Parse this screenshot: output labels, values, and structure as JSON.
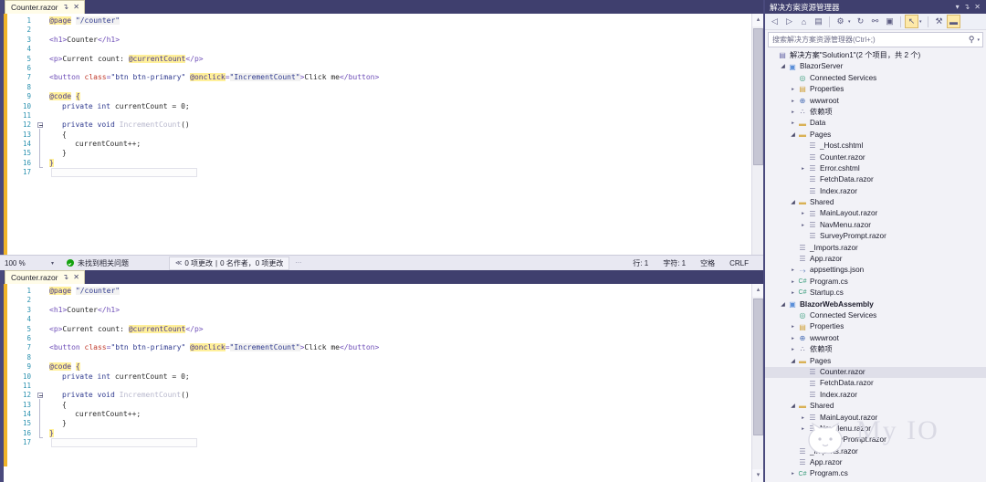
{
  "editor": {
    "tab": {
      "title": "Counter.razor",
      "pin_icon": "pin-icon",
      "close_icon": "close-icon",
      "close_glyph": "✕",
      "pin_glyph": "↴"
    },
    "line_count": 17,
    "code_lines": [
      {
        "n": 1,
        "indent": 0,
        "tokens": [
          {
            "t": "@page",
            "c": "hl-razor"
          },
          {
            "t": " ",
            "c": "t-plain"
          },
          {
            "t": "\"/counter\"",
            "c": "t-str hl-str-bg"
          }
        ]
      },
      {
        "n": 2,
        "indent": 0,
        "tokens": []
      },
      {
        "n": 3,
        "indent": 0,
        "tokens": [
          {
            "t": "<h1>",
            "c": "t-tag"
          },
          {
            "t": "Counter",
            "c": "t-text"
          },
          {
            "t": "</h1>",
            "c": "t-tag"
          }
        ]
      },
      {
        "n": 4,
        "indent": 0,
        "tokens": []
      },
      {
        "n": 5,
        "indent": 0,
        "tokens": [
          {
            "t": "<p>",
            "c": "t-tag"
          },
          {
            "t": "Current count: ",
            "c": "t-text"
          },
          {
            "t": "@currentCount",
            "c": "hl-razor"
          },
          {
            "t": "</p>",
            "c": "t-tag"
          }
        ]
      },
      {
        "n": 6,
        "indent": 0,
        "tokens": []
      },
      {
        "n": 7,
        "indent": 0,
        "tokens": [
          {
            "t": "<button ",
            "c": "t-tag"
          },
          {
            "t": "class",
            "c": "t-attr"
          },
          {
            "t": "=",
            "c": "t-tag"
          },
          {
            "t": "\"btn btn-primary\"",
            "c": "t-str"
          },
          {
            "t": " ",
            "c": "t-plain"
          },
          {
            "t": "@onclick",
            "c": "hl-razor"
          },
          {
            "t": "=",
            "c": "t-tag"
          },
          {
            "t": "\"IncrementCount\"",
            "c": "t-str hl-str-bg"
          },
          {
            "t": ">",
            "c": "t-tag"
          },
          {
            "t": "Click me",
            "c": "t-text"
          },
          {
            "t": "</button>",
            "c": "t-tag"
          }
        ]
      },
      {
        "n": 8,
        "indent": 0,
        "tokens": []
      },
      {
        "n": 9,
        "indent": 0,
        "tokens": [
          {
            "t": "@code",
            "c": "hl-razor"
          },
          {
            "t": " ",
            "c": "t-plain"
          },
          {
            "t": "{",
            "c": "hl-brace"
          }
        ]
      },
      {
        "n": 10,
        "indent": 1,
        "tokens": [
          {
            "t": "private",
            "c": "t-kw"
          },
          {
            "t": " ",
            "c": "t-plain"
          },
          {
            "t": "int",
            "c": "t-type"
          },
          {
            "t": " currentCount = ",
            "c": "t-plain"
          },
          {
            "t": "0",
            "c": "t-num"
          },
          {
            "t": ";",
            "c": "t-plain"
          }
        ]
      },
      {
        "n": 11,
        "indent": 0,
        "tokens": []
      },
      {
        "n": 12,
        "indent": 1,
        "fold": "start",
        "tokens": [
          {
            "t": "private",
            "c": "t-kw"
          },
          {
            "t": " ",
            "c": "t-plain"
          },
          {
            "t": "void",
            "c": "t-kw"
          },
          {
            "t": " ",
            "c": "t-plain"
          },
          {
            "t": "IncrementCount",
            "c": "t-ident"
          },
          {
            "t": "()",
            "c": "t-plain"
          }
        ]
      },
      {
        "n": 13,
        "indent": 1,
        "tokens": [
          {
            "t": "{",
            "c": "t-plain"
          }
        ]
      },
      {
        "n": 14,
        "indent": 2,
        "tokens": [
          {
            "t": "currentCount++;",
            "c": "t-plain"
          }
        ]
      },
      {
        "n": 15,
        "indent": 1,
        "tokens": [
          {
            "t": "}",
            "c": "t-plain"
          }
        ]
      },
      {
        "n": 16,
        "indent": 0,
        "tokens": [
          {
            "t": "}",
            "c": "hl-brace"
          }
        ]
      },
      {
        "n": 17,
        "indent": 0,
        "tokens": []
      }
    ]
  },
  "statusbar": {
    "zoom_level": "100 %",
    "zoom_caret": "▾",
    "issue_status": "未找到相关问题",
    "ok_icon": "check-circle-icon",
    "changes_chevron": "≪",
    "changes_text": "0 项更改",
    "changes_separator": "|",
    "authors_text": "0 名作者，0 项更改",
    "overflow_dots": "⋯",
    "line_label": "行: 1",
    "char_label": "字符: 1",
    "space_label": "空格",
    "eol_label": "CRLF"
  },
  "solution_explorer": {
    "title": "解决方案资源管理器",
    "titlebar_buttons": [
      {
        "name": "chevron-down-icon",
        "glyph": "▾"
      },
      {
        "name": "pin-icon",
        "glyph": "↴"
      },
      {
        "name": "close-icon",
        "glyph": "✕"
      }
    ],
    "toolbar": [
      {
        "name": "back-icon",
        "glyph": "◁",
        "active": false,
        "caret": false
      },
      {
        "name": "forward-icon",
        "glyph": "▷",
        "active": false,
        "caret": false
      },
      {
        "name": "home-icon",
        "glyph": "⌂",
        "active": false,
        "caret": false
      },
      {
        "name": "collapse-all-icon",
        "glyph": "▤",
        "active": false,
        "caret": false
      },
      {
        "name": "separator",
        "glyph": "",
        "sep": true
      },
      {
        "name": "show-all-files-icon",
        "glyph": "⚙",
        "active": false,
        "caret": true
      },
      {
        "name": "refresh-icon",
        "glyph": "↻",
        "active": false,
        "caret": false
      },
      {
        "name": "link-icon",
        "glyph": "⚯",
        "active": false,
        "caret": false
      },
      {
        "name": "preview-selected-items-icon",
        "glyph": "▣",
        "active": false,
        "caret": false
      },
      {
        "name": "separator",
        "glyph": "",
        "sep": true
      },
      {
        "name": "pointer-icon",
        "glyph": "↖",
        "active": true,
        "caret": true
      },
      {
        "name": "separator",
        "glyph": "",
        "sep": true
      },
      {
        "name": "properties-icon",
        "glyph": "⚒",
        "active": false,
        "caret": false
      },
      {
        "name": "solution-pane-icon",
        "glyph": "▬",
        "active": true,
        "caret": false
      }
    ],
    "search_placeholder": "搜索解决方案资源管理器(Ctrl+;)",
    "search_icon": "search-icon",
    "search_glyph": "⚲",
    "search_caret": "▾",
    "tree": [
      {
        "depth": 0,
        "tw": "",
        "icon": "▤",
        "icon_class": "icon-sln",
        "label": "解决方案\"Solution1\"(2 个项目，共 2 个)",
        "bold": false,
        "selected": false,
        "name": "tree-node-solution"
      },
      {
        "depth": 1,
        "tw": "open",
        "icon": "▣",
        "icon_class": "icon-proj",
        "label": "BlazorServer",
        "bold": false,
        "selected": false,
        "name": "tree-node-blazorserver"
      },
      {
        "depth": 2,
        "tw": "",
        "icon": "◎",
        "icon_class": "icon-conn",
        "label": "Connected Services",
        "bold": false,
        "selected": false,
        "name": "tree-node-connected-services"
      },
      {
        "depth": 2,
        "tw": "▸",
        "icon": "▤",
        "icon_class": "icon-props",
        "label": "Properties",
        "bold": false,
        "selected": false,
        "name": "tree-node-properties"
      },
      {
        "depth": 2,
        "tw": "▸",
        "icon": "⊕",
        "icon_class": "icon-web",
        "label": "wwwroot",
        "bold": false,
        "selected": false,
        "name": "tree-node-wwwroot"
      },
      {
        "depth": 2,
        "tw": "▸",
        "icon": "∴",
        "icon_class": "icon-dep",
        "label": "依赖项",
        "bold": false,
        "selected": false,
        "name": "tree-node-dependencies"
      },
      {
        "depth": 2,
        "tw": "▸",
        "icon": "▬",
        "icon_class": "icon-folder",
        "label": "Data",
        "bold": false,
        "selected": false,
        "name": "tree-node-data"
      },
      {
        "depth": 2,
        "tw": "open",
        "icon": "▬",
        "icon_class": "icon-folder",
        "label": "Pages",
        "bold": false,
        "selected": false,
        "name": "tree-node-pages"
      },
      {
        "depth": 3,
        "tw": "",
        "icon": "☰",
        "icon_class": "icon-file",
        "label": "_Host.cshtml",
        "bold": false,
        "selected": false,
        "name": "tree-node-host-cshtml"
      },
      {
        "depth": 3,
        "tw": "",
        "icon": "☰",
        "icon_class": "icon-file",
        "label": "Counter.razor",
        "bold": false,
        "selected": false,
        "name": "tree-node-counter-razor"
      },
      {
        "depth": 3,
        "tw": "▸",
        "icon": "☰",
        "icon_class": "icon-file",
        "label": "Error.cshtml",
        "bold": false,
        "selected": false,
        "name": "tree-node-error-cshtml"
      },
      {
        "depth": 3,
        "tw": "",
        "icon": "☰",
        "icon_class": "icon-file",
        "label": "FetchData.razor",
        "bold": false,
        "selected": false,
        "name": "tree-node-fetchdata-razor"
      },
      {
        "depth": 3,
        "tw": "",
        "icon": "☰",
        "icon_class": "icon-file",
        "label": "Index.razor",
        "bold": false,
        "selected": false,
        "name": "tree-node-index-razor"
      },
      {
        "depth": 2,
        "tw": "open",
        "icon": "▬",
        "icon_class": "icon-folder",
        "label": "Shared",
        "bold": false,
        "selected": false,
        "name": "tree-node-shared"
      },
      {
        "depth": 3,
        "tw": "▸",
        "icon": "☰",
        "icon_class": "icon-file",
        "label": "MainLayout.razor",
        "bold": false,
        "selected": false,
        "name": "tree-node-mainlayout-razor"
      },
      {
        "depth": 3,
        "tw": "▸",
        "icon": "☰",
        "icon_class": "icon-file",
        "label": "NavMenu.razor",
        "bold": false,
        "selected": false,
        "name": "tree-node-navmenu-razor"
      },
      {
        "depth": 3,
        "tw": "",
        "icon": "☰",
        "icon_class": "icon-file",
        "label": "SurveyPrompt.razor",
        "bold": false,
        "selected": false,
        "name": "tree-node-surveyprompt-razor"
      },
      {
        "depth": 2,
        "tw": "",
        "icon": "☰",
        "icon_class": "icon-file",
        "label": "_Imports.razor",
        "bold": false,
        "selected": false,
        "name": "tree-node-imports-razor"
      },
      {
        "depth": 2,
        "tw": "",
        "icon": "☰",
        "icon_class": "icon-file",
        "label": "App.razor",
        "bold": false,
        "selected": false,
        "name": "tree-node-app-razor"
      },
      {
        "depth": 2,
        "tw": "▸",
        "icon": "⤑",
        "icon_class": "icon-json",
        "label": "appsettings.json",
        "bold": false,
        "selected": false,
        "name": "tree-node-appsettings-json"
      },
      {
        "depth": 2,
        "tw": "▸",
        "icon": "C#",
        "icon_class": "icon-cs",
        "label": "Program.cs",
        "bold": false,
        "selected": false,
        "name": "tree-node-program-cs"
      },
      {
        "depth": 2,
        "tw": "▸",
        "icon": "C#",
        "icon_class": "icon-cs",
        "label": "Startup.cs",
        "bold": false,
        "selected": false,
        "name": "tree-node-startup-cs"
      },
      {
        "depth": 1,
        "tw": "open",
        "icon": "▣",
        "icon_class": "icon-proj",
        "label": "BlazorWebAssembly",
        "bold": true,
        "selected": false,
        "name": "tree-node-blazorwebassembly"
      },
      {
        "depth": 2,
        "tw": "",
        "icon": "◎",
        "icon_class": "icon-conn",
        "label": "Connected Services",
        "bold": false,
        "selected": false,
        "name": "tree-node-wasm-connected-services"
      },
      {
        "depth": 2,
        "tw": "▸",
        "icon": "▤",
        "icon_class": "icon-props",
        "label": "Properties",
        "bold": false,
        "selected": false,
        "name": "tree-node-wasm-properties"
      },
      {
        "depth": 2,
        "tw": "▸",
        "icon": "⊕",
        "icon_class": "icon-web",
        "label": "wwwroot",
        "bold": false,
        "selected": false,
        "name": "tree-node-wasm-wwwroot"
      },
      {
        "depth": 2,
        "tw": "▸",
        "icon": "∴",
        "icon_class": "icon-dep",
        "label": "依赖项",
        "bold": false,
        "selected": false,
        "name": "tree-node-wasm-dependencies"
      },
      {
        "depth": 2,
        "tw": "open",
        "icon": "▬",
        "icon_class": "icon-folder",
        "label": "Pages",
        "bold": false,
        "selected": false,
        "name": "tree-node-wasm-pages"
      },
      {
        "depth": 3,
        "tw": "",
        "icon": "☰",
        "icon_class": "icon-file",
        "label": "Counter.razor",
        "bold": false,
        "selected": true,
        "name": "tree-node-wasm-counter-razor"
      },
      {
        "depth": 3,
        "tw": "",
        "icon": "☰",
        "icon_class": "icon-file",
        "label": "FetchData.razor",
        "bold": false,
        "selected": false,
        "name": "tree-node-wasm-fetchdata-razor"
      },
      {
        "depth": 3,
        "tw": "",
        "icon": "☰",
        "icon_class": "icon-file",
        "label": "Index.razor",
        "bold": false,
        "selected": false,
        "name": "tree-node-wasm-index-razor"
      },
      {
        "depth": 2,
        "tw": "open",
        "icon": "▬",
        "icon_class": "icon-folder",
        "label": "Shared",
        "bold": false,
        "selected": false,
        "name": "tree-node-wasm-shared"
      },
      {
        "depth": 3,
        "tw": "▸",
        "icon": "☰",
        "icon_class": "icon-file",
        "label": "MainLayout.razor",
        "bold": false,
        "selected": false,
        "name": "tree-node-wasm-mainlayout-razor"
      },
      {
        "depth": 3,
        "tw": "▸",
        "icon": "☰",
        "icon_class": "icon-file",
        "label": "NavMenu.razor",
        "bold": false,
        "selected": false,
        "name": "tree-node-wasm-navmenu-razor"
      },
      {
        "depth": 3,
        "tw": "",
        "icon": "☰",
        "icon_class": "icon-file",
        "label": "SurveyPrompt.razor",
        "bold": false,
        "selected": false,
        "name": "tree-node-wasm-surveyprompt-razor"
      },
      {
        "depth": 2,
        "tw": "",
        "icon": "☰",
        "icon_class": "icon-file",
        "label": "_Imports.razor",
        "bold": false,
        "selected": false,
        "name": "tree-node-wasm-imports-razor"
      },
      {
        "depth": 2,
        "tw": "",
        "icon": "☰",
        "icon_class": "icon-file",
        "label": "App.razor",
        "bold": false,
        "selected": false,
        "name": "tree-node-wasm-app-razor"
      },
      {
        "depth": 2,
        "tw": "▸",
        "icon": "C#",
        "icon_class": "icon-cs",
        "label": "Program.cs",
        "bold": false,
        "selected": false,
        "name": "tree-node-wasm-program-cs"
      }
    ]
  },
  "watermark": {
    "text": "My IO"
  },
  "colors": {
    "chrome": "#3f3f6e",
    "accent_highlight": "#fff09a",
    "selection": "#dfdfe9",
    "change_bar": "#f0b429",
    "ok_green": "#13a10e"
  }
}
